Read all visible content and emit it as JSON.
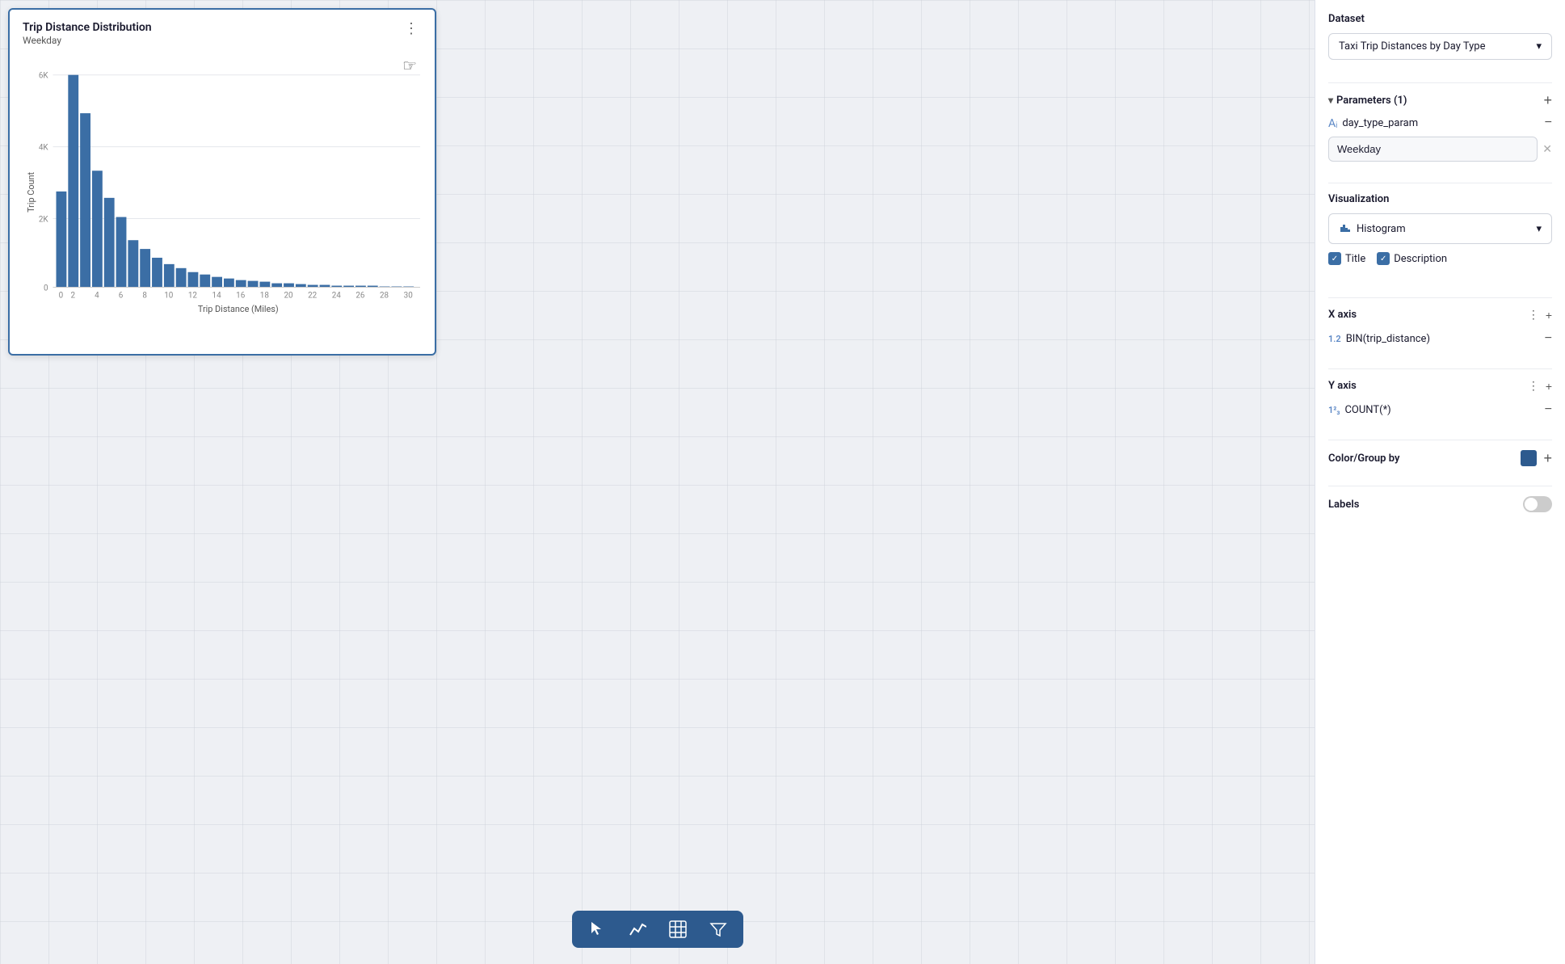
{
  "header": {
    "dataset_label": "Dataset",
    "dataset_value": "Taxi Trip Distances by Day Type",
    "dataset_dropdown_icon": "▾"
  },
  "parameters": {
    "section_title": "Parameters (1)",
    "chevron": "▾",
    "add_icon": "+",
    "param": {
      "icon": "Aᵢ",
      "name": "day_type_param",
      "minus": "−",
      "value": "Weekday",
      "clear_icon": "✕"
    }
  },
  "visualization": {
    "section_title": "Visualization",
    "type": "Histogram",
    "dropdown_icon": "▾",
    "title_label": "Title",
    "description_label": "Description"
  },
  "x_axis": {
    "section_title": "X axis",
    "field_type": "1.2",
    "field_name": "BIN(trip_distance)",
    "minus": "−"
  },
  "y_axis": {
    "section_title": "Y axis",
    "field_type": "1²₃",
    "field_name": "COUNT(*)",
    "minus": "−"
  },
  "color_group": {
    "section_title": "Color/Group by",
    "color": "#2d5a8e",
    "add_icon": "+"
  },
  "labels": {
    "section_title": "Labels"
  },
  "chart": {
    "title": "Trip Distance Distribution",
    "subtitle": "Weekday",
    "y_axis_label": "Trip Count",
    "x_axis_label": "Trip Distance (Miles)",
    "y_ticks": [
      "6K",
      "4K",
      "2K",
      "0"
    ],
    "x_ticks": [
      "0",
      "2",
      "4",
      "6",
      "8",
      "10",
      "12",
      "14",
      "16",
      "18",
      "20",
      "22",
      "24",
      "26",
      "28",
      "30"
    ],
    "bars": [
      {
        "label": "0-1",
        "height": 0.45
      },
      {
        "label": "1-2",
        "height": 1.0
      },
      {
        "label": "2-3",
        "height": 0.82
      },
      {
        "label": "3-4",
        "height": 0.55
      },
      {
        "label": "4-5",
        "height": 0.42
      },
      {
        "label": "5-6",
        "height": 0.33
      },
      {
        "label": "6-7",
        "height": 0.22
      },
      {
        "label": "7-8",
        "height": 0.18
      },
      {
        "label": "8-9",
        "height": 0.14
      },
      {
        "label": "9-10",
        "height": 0.11
      },
      {
        "label": "10-11",
        "height": 0.09
      },
      {
        "label": "11-12",
        "height": 0.07
      },
      {
        "label": "12-13",
        "height": 0.06
      },
      {
        "label": "13-14",
        "height": 0.05
      },
      {
        "label": "14-15",
        "height": 0.04
      },
      {
        "label": "15-16",
        "height": 0.035
      },
      {
        "label": "16-17",
        "height": 0.03
      },
      {
        "label": "17-18",
        "height": 0.025
      },
      {
        "label": "18-19",
        "height": 0.02
      },
      {
        "label": "19-20",
        "height": 0.018
      },
      {
        "label": "20-21",
        "height": 0.015
      },
      {
        "label": "21-22",
        "height": 0.012
      },
      {
        "label": "22-23",
        "height": 0.01
      },
      {
        "label": "23-24",
        "height": 0.009
      },
      {
        "label": "24-25",
        "height": 0.008
      },
      {
        "label": "25-26",
        "height": 0.007
      },
      {
        "label": "26-27",
        "height": 0.006
      },
      {
        "label": "27-28",
        "height": 0.005
      },
      {
        "label": "28-29",
        "height": 0.005
      },
      {
        "label": "29-30",
        "height": 0.004
      }
    ],
    "bar_color": "#3b6ea5"
  },
  "toolbar": {
    "cursor_icon": "▶",
    "chart_icon": "📈",
    "table_icon": "⊞",
    "filter_icon": "⋁"
  }
}
